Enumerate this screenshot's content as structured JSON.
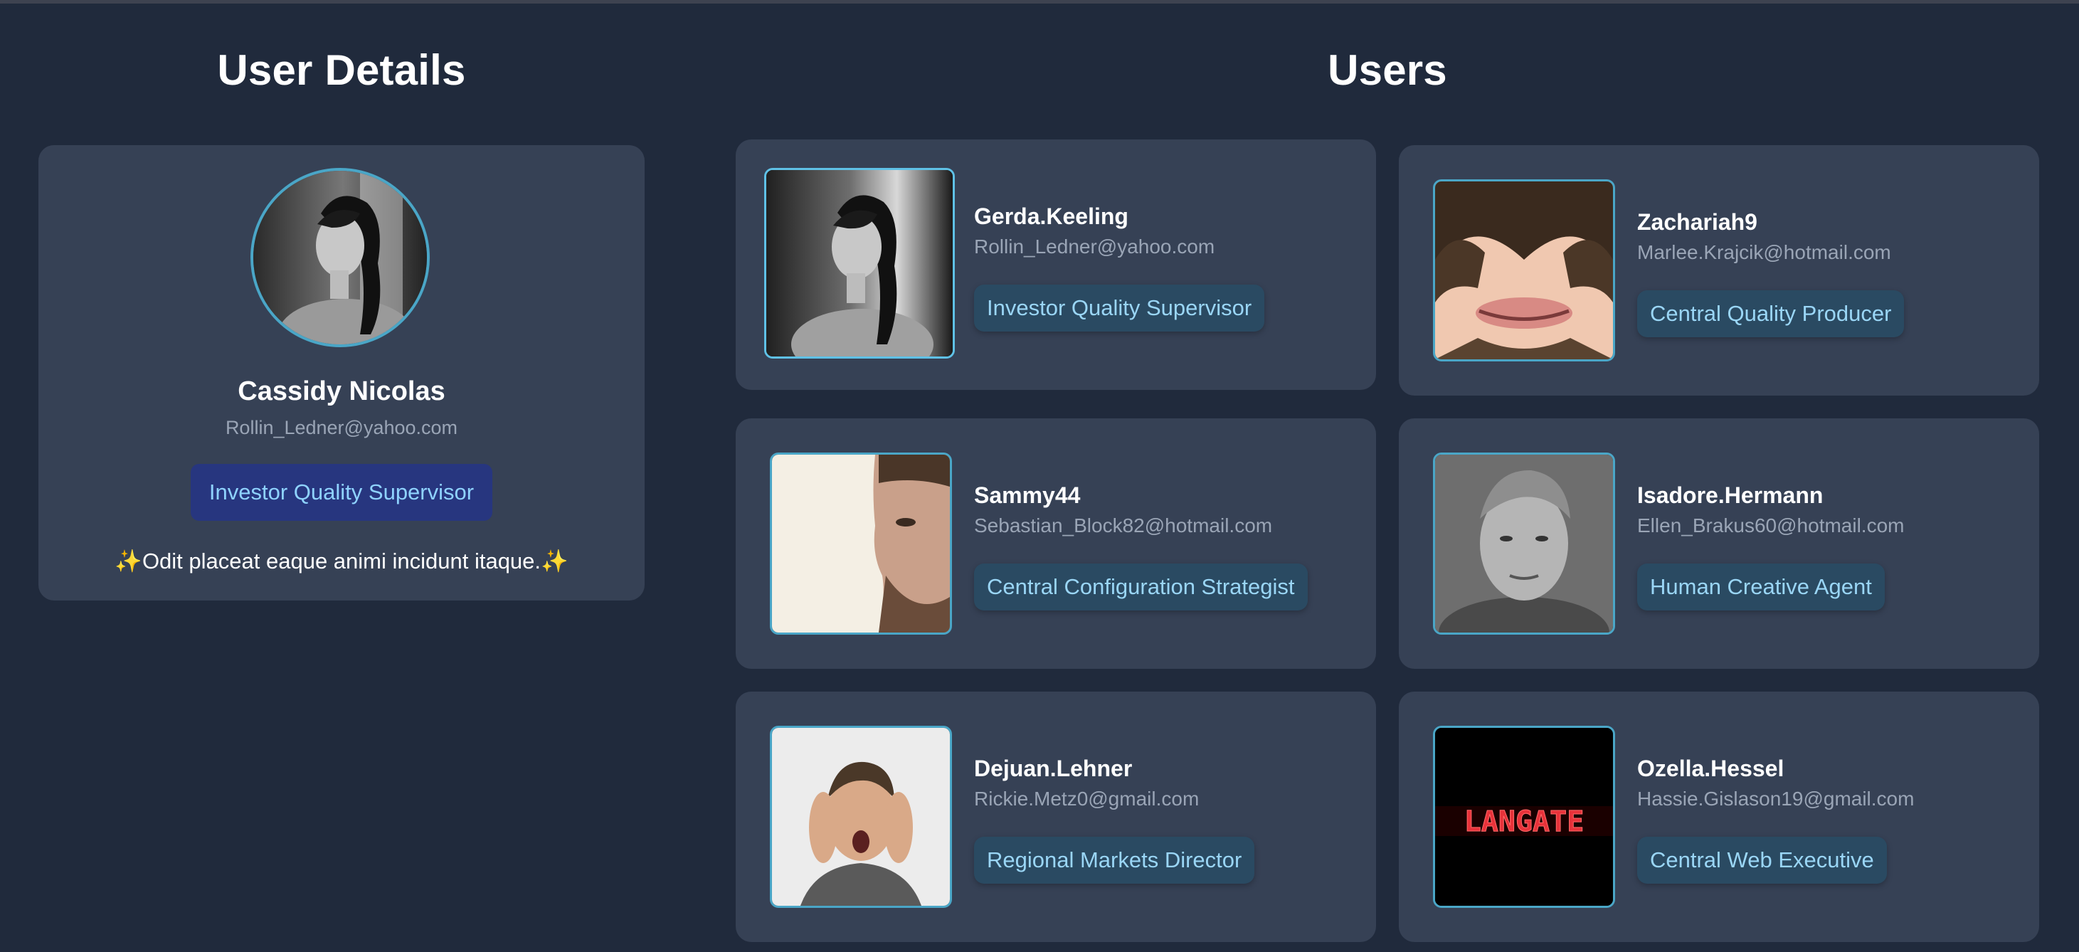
{
  "details": {
    "title": "User Details",
    "name": "Cassidy Nicolas",
    "email": "Rollin_Ledner@yahoo.com",
    "role": "Investor Quality Supervisor",
    "bio": "✨Odit placeat eaque animi incidunt itaque.✨"
  },
  "users": {
    "title": "Users",
    "items": [
      {
        "username": "Gerda.Keeling",
        "email": "Rollin_Ledner@yahoo.com",
        "role": "Investor Quality Supervisor",
        "selected": true
      },
      {
        "username": "Zachariah9",
        "email": "Marlee.Krajcik@hotmail.com",
        "role": "Central Quality Producer"
      },
      {
        "username": "Sammy44",
        "email": "Sebastian_Block82@hotmail.com",
        "role": "Central Configuration Strategist"
      },
      {
        "username": "Isadore.Hermann",
        "email": "Ellen_Brakus60@hotmail.com",
        "role": "Human Creative Agent"
      },
      {
        "username": "Dejuan.Lehner",
        "email": "Rickie.Metz0@gmail.com",
        "role": "Regional Markets Director"
      },
      {
        "username": "Ozella.Hessel",
        "email": "Hassie.Gislason19@gmail.com",
        "role": "Central Web Executive",
        "logo_text": "LANGATE"
      }
    ]
  },
  "colors": {
    "background": "#202a3c",
    "card": "#364155",
    "accent_border": "#4aa6c7",
    "role_badge": "#2a4a62",
    "detail_role_badge": "#27367f"
  }
}
